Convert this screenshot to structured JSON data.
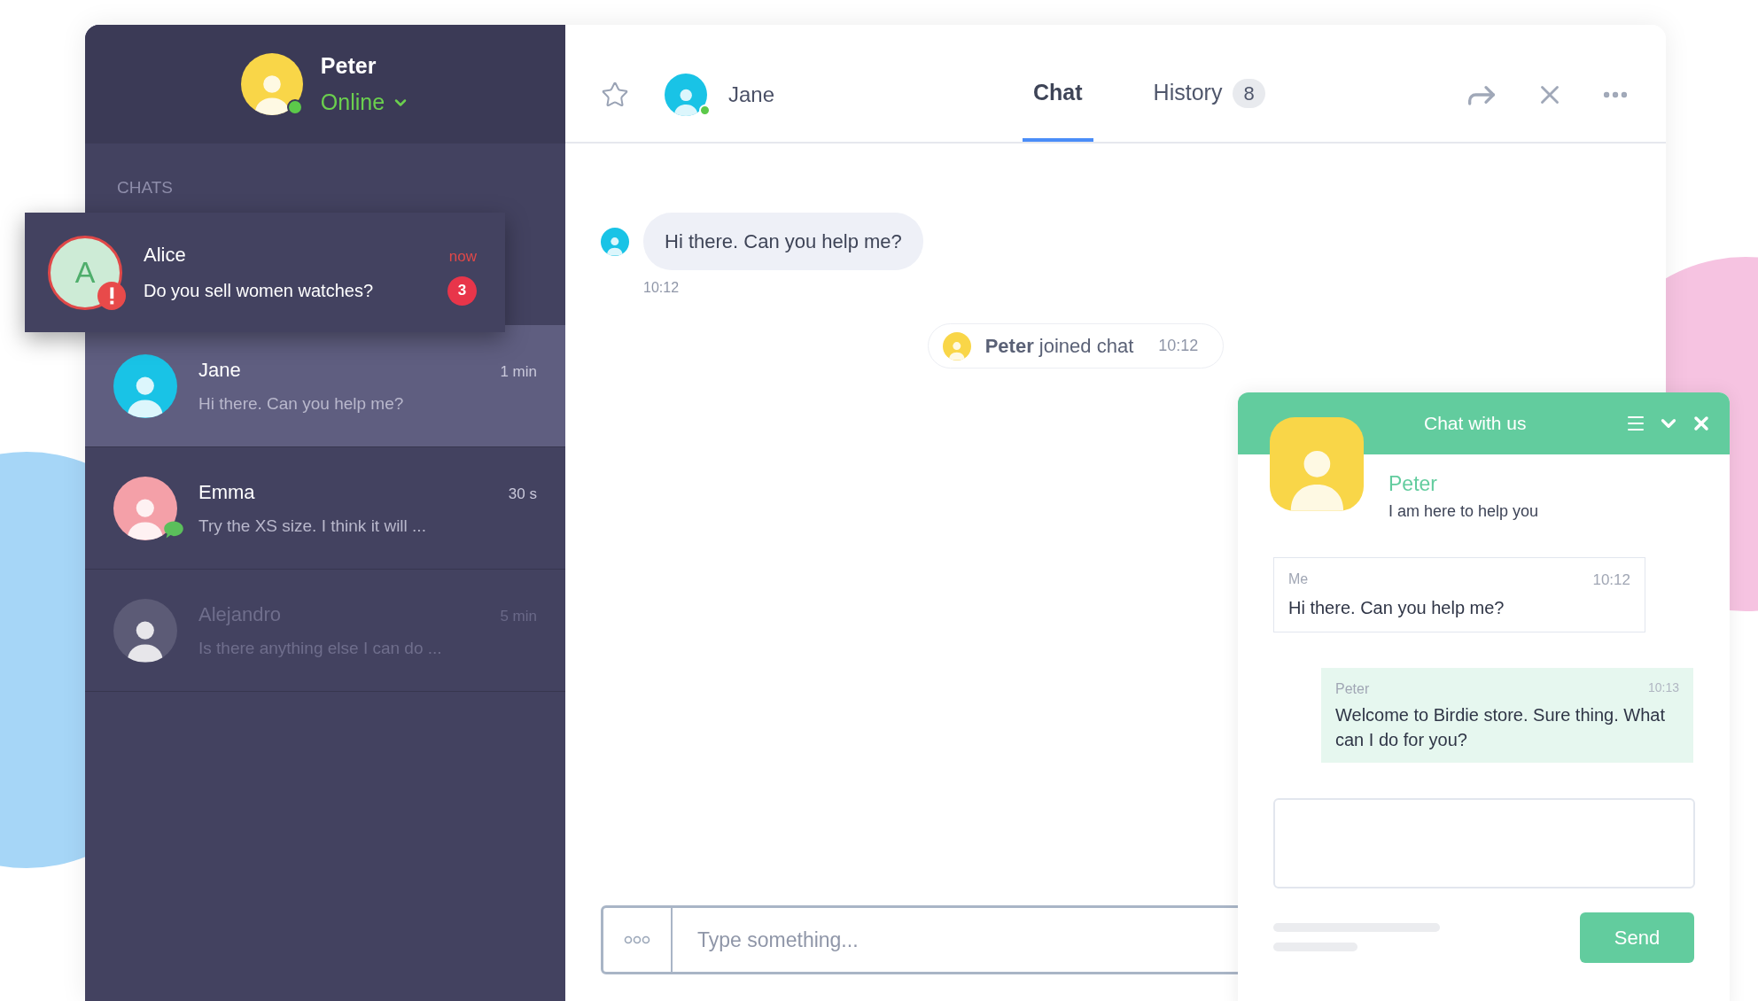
{
  "agent": {
    "name": "Peter",
    "status": "Online",
    "online": true,
    "color": "#f9d648"
  },
  "sidebar": {
    "section_title": "CHATS",
    "notification": {
      "initial": "A",
      "name": "Alice",
      "time": "now",
      "preview": "Do you sell women watches?",
      "unread": "3",
      "alert": true,
      "color": "#cdebd6"
    },
    "chats": [
      {
        "name": "Jane",
        "time": "1 min",
        "preview": "Hi there. Can you help me?",
        "selected": true,
        "dimmed": false,
        "new_message": false,
        "color": "#19c3e6"
      },
      {
        "name": "Emma",
        "time": "30 s",
        "preview": "Try the XS size. I think it will ...",
        "selected": false,
        "dimmed": false,
        "new_message": true,
        "color": "#f4a0a8"
      },
      {
        "name": "Alejandro",
        "time": "5 min",
        "preview": "Is there anything else I can do ...",
        "selected": false,
        "dimmed": true,
        "new_message": false,
        "color": "#5c5b76"
      }
    ]
  },
  "conversation": {
    "starred": false,
    "contact": {
      "name": "Jane",
      "online": true,
      "color": "#19c3e6"
    },
    "tabs": [
      {
        "label": "Chat",
        "selected": true
      },
      {
        "label": "History",
        "selected": false,
        "count": "8"
      }
    ],
    "messages": [
      {
        "kind": "incoming",
        "text": "Hi there. Can you help me?",
        "time": "10:12",
        "color": "#19c3e6"
      },
      {
        "kind": "event",
        "text": "**Peter** joined chat",
        "time": "10:12",
        "color": "#f9d648"
      }
    ],
    "composer": {
      "placeholder": "Type something..."
    }
  },
  "widget": {
    "title": "Chat with us",
    "agent_name": "Peter",
    "agent_tagline": "I am here to help you",
    "messages": [
      {
        "kind": "visitor",
        "author": "Me",
        "time": "10:12",
        "text": "Hi there. Can you help me?"
      },
      {
        "kind": "agent",
        "author": "Peter",
        "time": "10:13",
        "text": "Welcome to Birdie store. Sure thing. What can I do for you?"
      }
    ],
    "send_label": "Send"
  }
}
